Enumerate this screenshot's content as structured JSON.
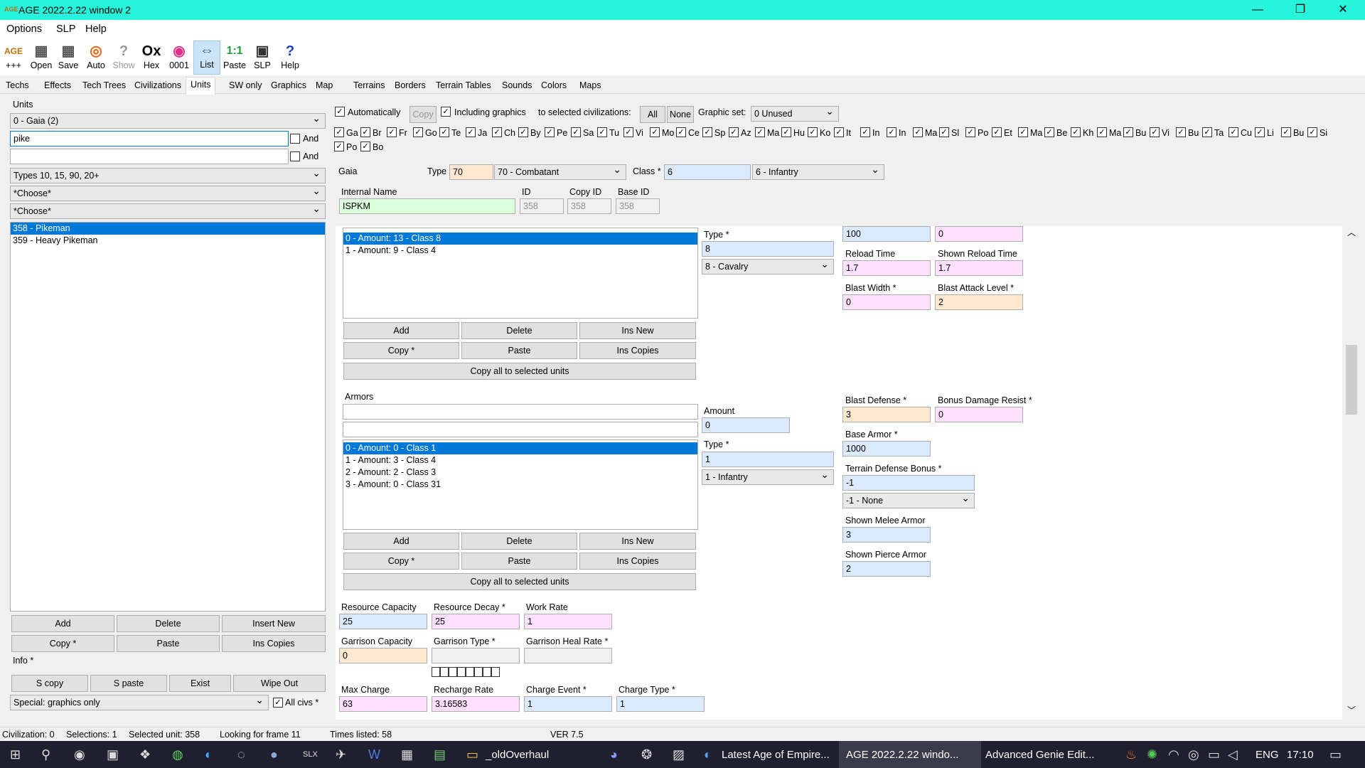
{
  "window": {
    "title": "AGE 2022.2.22 window 2",
    "icon": "AGE",
    "minimize": "—",
    "maximize": "❐",
    "close": "✕"
  },
  "menu": [
    "Options",
    "SLP",
    "Help"
  ],
  "toolbar": [
    {
      "icon": "AGE",
      "label": "+++"
    },
    {
      "icon": "▦",
      "label": "Open"
    },
    {
      "icon": "▦",
      "label": "Save"
    },
    {
      "icon": "◎",
      "label": "Auto"
    },
    {
      "icon": "?",
      "label": "Show"
    },
    {
      "icon": "Ox",
      "label": "Hex"
    },
    {
      "icon": "◉",
      "label": "0001"
    },
    {
      "icon": "⇔",
      "label": "List"
    },
    {
      "icon": "1:1",
      "label": "Paste"
    },
    {
      "icon": "▣",
      "label": "SLP"
    },
    {
      "icon": "?",
      "label": "Help"
    }
  ],
  "tabs": [
    "Techs",
    "Effects",
    "Tech Trees",
    "Civilizations",
    "Units",
    "SW only",
    "Graphics",
    "Map",
    "Terrains",
    "Borders",
    "Terrain Tables",
    "Sounds",
    "Colors",
    "Maps"
  ],
  "left": {
    "units_label": "Units",
    "civ_select": "0 - Gaia (2)",
    "search1": "pike",
    "search2": "",
    "and": "And",
    "filter1": "Types 10, 15, 90, 20+",
    "filter2": "*Choose*",
    "filter3": "*Choose*",
    "units": [
      "358 - Pikeman",
      "359 - Heavy Pikeman"
    ],
    "buttons": [
      "Add",
      "Delete",
      "Insert New",
      "Copy *",
      "Paste",
      "Ins Copies"
    ],
    "info": "Info *",
    "buttons2": [
      "S copy",
      "S paste",
      "Exist",
      "Wipe Out"
    ],
    "special": "Special: graphics only",
    "allcivs": "All civs *"
  },
  "top": {
    "automatically": "Automatically",
    "copy": "Copy",
    "including_graphics": "Including graphics",
    "to_selected": "to selected civilizations:",
    "all": "All",
    "none": "None",
    "graphic_set_label": "Graphic set:",
    "graphic_set": "0 Unused",
    "civs": [
      "Ga",
      "Br",
      "Fr",
      "Go",
      "Te",
      "Ja",
      "Ch",
      "By",
      "Pe",
      "Sa",
      "Tu",
      "Vi",
      "Mo",
      "Ce",
      "Sp",
      "Az",
      "Ma",
      "Hu",
      "Ko",
      "It",
      "In",
      "In",
      "Ma",
      "Sl",
      "Po",
      "Et",
      "Ma",
      "Be",
      "Kh",
      "Ma",
      "Bu",
      "Vi",
      "Bu",
      "Ta",
      "Cu",
      "Li",
      "Bu",
      "Si",
      "Po",
      "Bo"
    ]
  },
  "header": {
    "civ": "Gaia",
    "type_label": "Type",
    "type": "70",
    "type_name": "70 - Combatant",
    "class_label": "Class *",
    "class": "6",
    "class_name": "6 - Infantry",
    "internal_name_label": "Internal Name",
    "internal_name": "ISPKM",
    "id_label": "ID",
    "id": "358",
    "copy_id_label": "Copy ID",
    "copy_id": "358",
    "base_id_label": "Base ID",
    "base_id": "358"
  },
  "attacks": {
    "items": [
      "0 - Amount: 13 - Class 8",
      "1 - Amount: 9 - Class 4"
    ],
    "type_label": "Type *",
    "type": "8",
    "type_name": "8 - Cavalry",
    "buttons": [
      "Add",
      "Delete",
      "Ins New",
      "Copy *",
      "Paste",
      "Ins Copies"
    ],
    "copy_all": "Copy all to selected units"
  },
  "armors": {
    "label": "Armors",
    "amount_label": "Amount",
    "amount": "0",
    "type_label": "Type *",
    "type": "1",
    "type_name": "1 - Infantry",
    "items": [
      "0 - Amount: 0 - Class 1",
      "1 - Amount: 3 - Class 4",
      "2 - Amount: 2 - Class 3",
      "3 - Amount: 0 - Class 31"
    ],
    "buttons": [
      "Add",
      "Delete",
      "Ins New",
      "Copy *",
      "Paste",
      "Ins Copies"
    ],
    "copy_all": "Copy all to selected units"
  },
  "right": {
    "v1": "100",
    "v2": "0",
    "reload_label": "Reload Time",
    "reload": "1.7",
    "shown_reload_label": "Shown Reload Time",
    "shown_reload": "1.7",
    "blast_width_label": "Blast Width *",
    "blast_width": "0",
    "blast_level_label": "Blast Attack Level *",
    "blast_level": "2",
    "blast_def_label": "Blast Defense *",
    "blast_def": "3",
    "bonus_resist_label": "Bonus Damage Resist *",
    "bonus_resist": "0",
    "base_armor_label": "Base Armor *",
    "base_armor": "1000",
    "terrain_def_label": "Terrain Defense Bonus *",
    "terrain_def": "-1",
    "terrain_def_name": "-1 - None",
    "melee_label": "Shown Melee Armor",
    "melee": "3",
    "pierce_label": "Shown Pierce Armor",
    "pierce": "2"
  },
  "bottom": {
    "res_cap_label": "Resource Capacity",
    "res_cap": "25",
    "res_decay_label": "Resource Decay *",
    "res_decay": "25",
    "work_rate_label": "Work Rate",
    "work_rate": "1",
    "garrison_cap_label": "Garrison Capacity",
    "garrison_cap": "0",
    "garrison_type_label": "Garrison Type *",
    "garrison_type": "",
    "garrison_heal_label": "Garrison Heal Rate *",
    "garrison_heal": "",
    "max_charge_label": "Max Charge",
    "max_charge": "63",
    "recharge_label": "Recharge Rate",
    "recharge": "3.16583",
    "charge_event_label": "Charge Event *",
    "charge_event": "1",
    "charge_type_label": "Charge Type *",
    "charge_type": "1"
  },
  "status": [
    "Civilization: 0",
    "Selections: 1",
    "Selected unit: 358",
    "Looking for frame 11",
    "Times listed: 58",
    "VER 7.5"
  ],
  "taskbar": {
    "folder": "_oldOverhaul",
    "edge": "Latest Age of Empire...",
    "age1": "AGE 2022.2.22 windo...",
    "age2": "Advanced Genie Edit...",
    "lang": "ENG",
    "time": "17:10"
  }
}
